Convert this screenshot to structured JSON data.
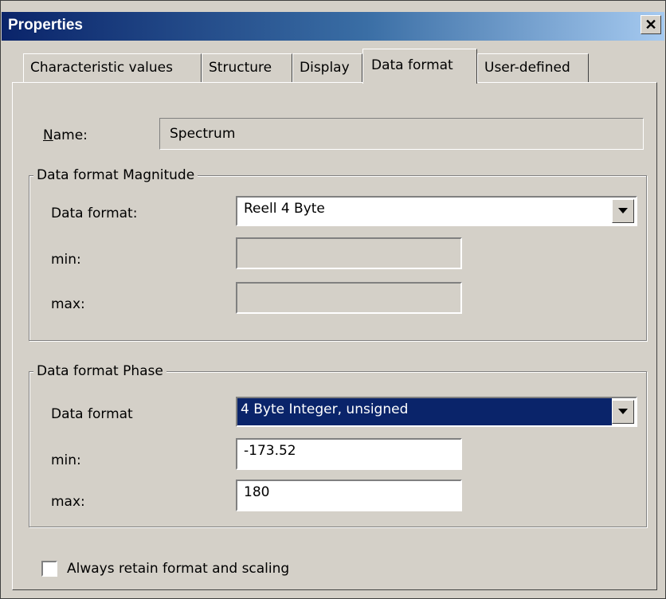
{
  "window": {
    "title": "Properties"
  },
  "tabs": [
    {
      "label": "Characteristic values"
    },
    {
      "label": "Structure"
    },
    {
      "label": "Display"
    },
    {
      "label": "Data format"
    },
    {
      "label": "User-defined"
    }
  ],
  "active_tab": "Data format",
  "name_field": {
    "label": "Name:",
    "value": "Spectrum"
  },
  "magnitude_group": {
    "legend": "Data format Magnitude",
    "data_format_label": "Data format:",
    "data_format_value": "Reell 4 Byte",
    "min_label": "min:",
    "min_value": "",
    "max_label": "max:",
    "max_value": ""
  },
  "phase_group": {
    "legend": "Data format Phase",
    "data_format_label": "Data format",
    "data_format_value": "4 Byte Integer, unsigned",
    "min_label": "min:",
    "min_value": "-173.52",
    "max_label": "max:",
    "max_value": "180"
  },
  "checkbox": {
    "label": "Always retain format and scaling",
    "checked": false
  },
  "colors": {
    "selection": "#0a246a",
    "dialog_bg": "#d4d0c8"
  }
}
